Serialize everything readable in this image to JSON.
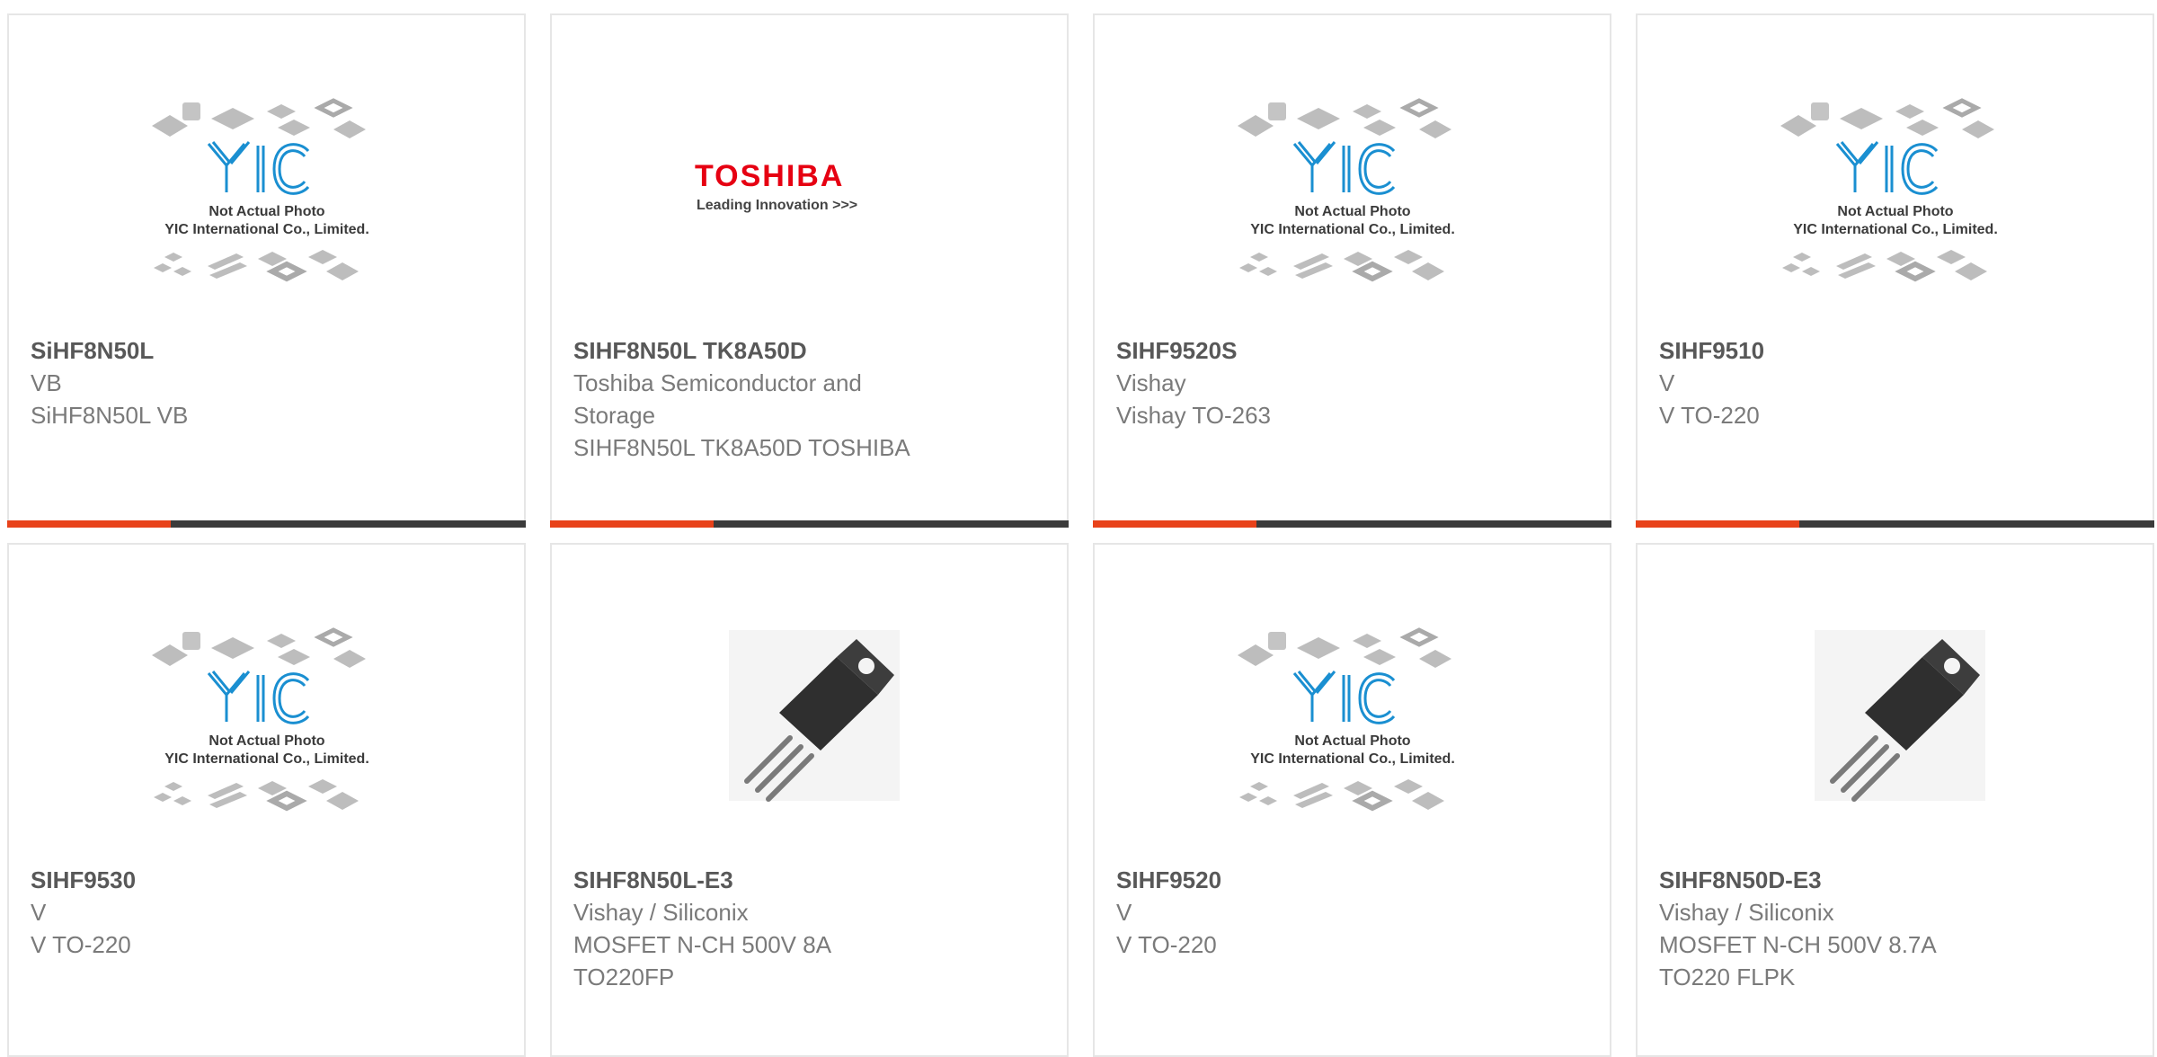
{
  "products": [
    {
      "part": "SiHF8N50L",
      "lines": [
        "VB",
        "SiHF8N50L VB"
      ],
      "image": "yic-placeholder"
    },
    {
      "part": "SIHF8N50L TK8A50D",
      "lines": [
        "Toshiba Semiconductor and",
        "Storage",
        "SIHF8N50L TK8A50D TOSHIBA"
      ],
      "image": "toshiba-logo"
    },
    {
      "part": "SIHF9520S",
      "lines": [
        "Vishay",
        "Vishay TO-263"
      ],
      "image": "yic-placeholder"
    },
    {
      "part": "SIHF9510",
      "lines": [
        "V",
        "V TO-220"
      ],
      "image": "yic-placeholder"
    },
    {
      "part": "SIHF9530",
      "lines": [
        "V",
        "V TO-220"
      ],
      "image": "yic-placeholder"
    },
    {
      "part": "SIHF8N50L-E3",
      "lines": [
        "Vishay / Siliconix",
        "MOSFET N-CH 500V 8A",
        "TO220FP"
      ],
      "image": "to220-package"
    },
    {
      "part": "SIHF9520",
      "lines": [
        "V",
        "V TO-220"
      ],
      "image": "yic-placeholder"
    },
    {
      "part": "SIHF8N50D-E3",
      "lines": [
        "Vishay / Siliconix",
        "MOSFET N-CH 500V 8.7A",
        "TO220 FLPK"
      ],
      "image": "to220-package"
    }
  ],
  "placeholder": {
    "logo": "YIC",
    "line1": "Not Actual Photo",
    "line2": "YIC International Co., Limited."
  },
  "toshiba": {
    "word": "TOSHIBA",
    "tagline": "Leading Innovation >>>"
  },
  "colors": {
    "accent": "#e8421a",
    "bar": "#3b3b3b",
    "yic_blue": "#1a8fd1",
    "toshiba_red": "#e60012"
  }
}
